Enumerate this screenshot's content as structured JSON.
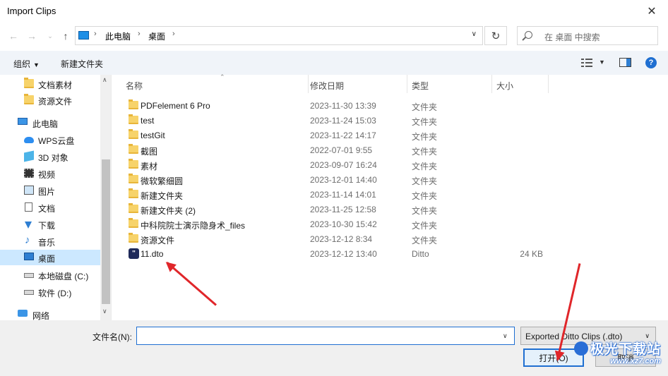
{
  "window": {
    "title": "Import Clips",
    "close_glyph": "✕"
  },
  "address": {
    "crumbs": [
      "此电脑",
      "桌面"
    ],
    "search_placeholder": "在 桌面 中搜索"
  },
  "toolbar": {
    "organize": "组织",
    "new_folder": "新建文件夹"
  },
  "sidebar": {
    "items": [
      {
        "label": "文档素材",
        "icon": "folder-icon"
      },
      {
        "label": "资源文件",
        "icon": "folder-icon"
      },
      {
        "label": "此电脑",
        "icon": "computer-icon"
      },
      {
        "label": "WPS云盘",
        "icon": "cloud-icon"
      },
      {
        "label": "3D 对象",
        "icon": "3d-objects-icon"
      },
      {
        "label": "视频",
        "icon": "video-icon"
      },
      {
        "label": "图片",
        "icon": "pictures-icon"
      },
      {
        "label": "文档",
        "icon": "documents-icon"
      },
      {
        "label": "下载",
        "icon": "download-icon"
      },
      {
        "label": "音乐",
        "icon": "music-icon"
      },
      {
        "label": "桌面",
        "icon": "desktop-icon",
        "selected": true
      },
      {
        "label": "本地磁盘 (C:)",
        "icon": "drive-icon"
      },
      {
        "label": "软件 (D:)",
        "icon": "drive-icon"
      },
      {
        "label": "网络",
        "icon": "network-icon"
      }
    ]
  },
  "columns": {
    "name": "名称",
    "date": "修改日期",
    "type": "类型",
    "size": "大小"
  },
  "files": [
    {
      "name": "PDFelement 6 Pro",
      "date": "2023-11-30 13:39",
      "type": "文件夹",
      "size": ""
    },
    {
      "name": "test",
      "date": "2023-11-24 15:03",
      "type": "文件夹",
      "size": ""
    },
    {
      "name": "testGit",
      "date": "2023-11-22 14:17",
      "type": "文件夹",
      "size": ""
    },
    {
      "name": "截图",
      "date": "2022-07-01 9:55",
      "type": "文件夹",
      "size": ""
    },
    {
      "name": "素材",
      "date": "2023-09-07 16:24",
      "type": "文件夹",
      "size": ""
    },
    {
      "name": "微软繁细圆",
      "date": "2023-12-01 14:40",
      "type": "文件夹",
      "size": ""
    },
    {
      "name": "新建文件夹",
      "date": "2023-11-14 14:01",
      "type": "文件夹",
      "size": ""
    },
    {
      "name": "新建文件夹 (2)",
      "date": "2023-11-25 12:58",
      "type": "文件夹",
      "size": ""
    },
    {
      "name": "中科院院士演示隐身术_files",
      "date": "2023-10-30 15:42",
      "type": "文件夹",
      "size": ""
    },
    {
      "name": "资源文件",
      "date": "2023-12-12 8:34",
      "type": "文件夹",
      "size": ""
    },
    {
      "name": "11.dto",
      "date": "2023-12-12 13:40",
      "type": "Ditto",
      "size": "24 KB",
      "icon": "ditto-file-icon"
    }
  ],
  "footer": {
    "filename_label": "文件名(N):",
    "filename_value": "",
    "filetype": "Exported Ditto Clips (.dto)",
    "open_button": "打开(O)",
    "cancel_button": "取消"
  },
  "watermark": {
    "text": "极光下载站",
    "url": "www.xz7.com"
  },
  "colors": {
    "accent": "#1f6fd1",
    "selection": "#cce8ff",
    "annotation_arrow": "#e0262a",
    "folder": "#f7d36a"
  }
}
